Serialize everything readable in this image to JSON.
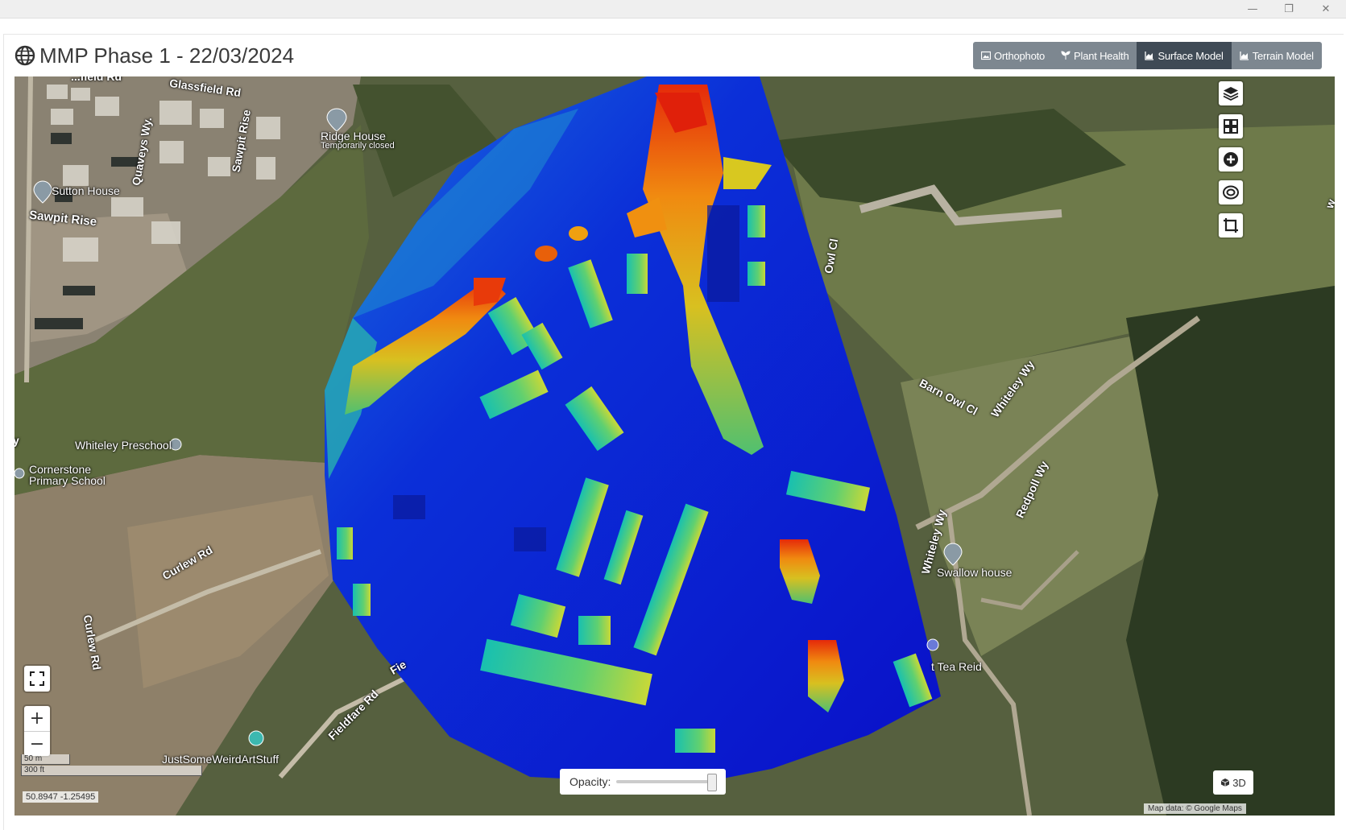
{
  "window": {
    "minimize_icon": "minimize-icon",
    "maximize_icon": "restore-icon",
    "close_icon": "close-icon"
  },
  "header": {
    "title": "MMP Phase 1 - 22/03/2024",
    "icon": "globe-icon"
  },
  "tabs": [
    {
      "label": "Orthophoto",
      "icon": "image-icon",
      "active": false
    },
    {
      "label": "Plant Health",
      "icon": "plant-icon",
      "active": false
    },
    {
      "label": "Surface Model",
      "icon": "chart-area-icon",
      "active": true
    },
    {
      "label": "Terrain Model",
      "icon": "chart-area-icon",
      "active": false
    }
  ],
  "map": {
    "labels": {
      "glassfield": "Glassfield Rd",
      "field_rd": "...field Rd",
      "quaveys": "Quaveys Wy.",
      "sawpit_rise_v": "Sawpit Rise",
      "sawpit_rise": "Sawpit Rise",
      "ridge_house": "Ridge House",
      "ridge_status": "Temporarily closed",
      "sutton_house": "Sutton House",
      "preschool": "Whiteley Preschool",
      "cornerstone1": "Cornerstone",
      "cornerstone2": "Primary School",
      "curlew1": "Curlew Rd",
      "curlew2": "Curlew Rd",
      "fieldfare": "Fieldfare Rd",
      "fie": "Fie",
      "barn_owl": "Barn Owl Cl",
      "owl_cl": "Owl Cl",
      "whiteley_wy": "Whiteley Wy",
      "whiteley_wy2": "Whiteley Wy",
      "redpoll": "Redpoll Wy",
      "swallow": "Swallow house",
      "tea_reid": "t Tea Reid",
      "artstuff": "JustSomeWeirdArtStuff",
      "y": "y",
      "w": "w"
    },
    "controls": [
      "layers-icon",
      "grid-icon",
      "add-icon",
      "target-icon",
      "crop-icon"
    ],
    "scale_m": "50 m",
    "scale_ft": "300 ft",
    "coordinates": "50.8947 -1.25495",
    "opacity_label": "Opacity:",
    "opacity_value": 1.0,
    "btn_3d": "3D",
    "attribution": "Map data: © Google Maps"
  },
  "colors": {
    "tab_bg": "#7d8790",
    "tab_active": "#3f4a55",
    "dsm_low": "#0a10d0",
    "dsm_high": "#e8300a"
  }
}
